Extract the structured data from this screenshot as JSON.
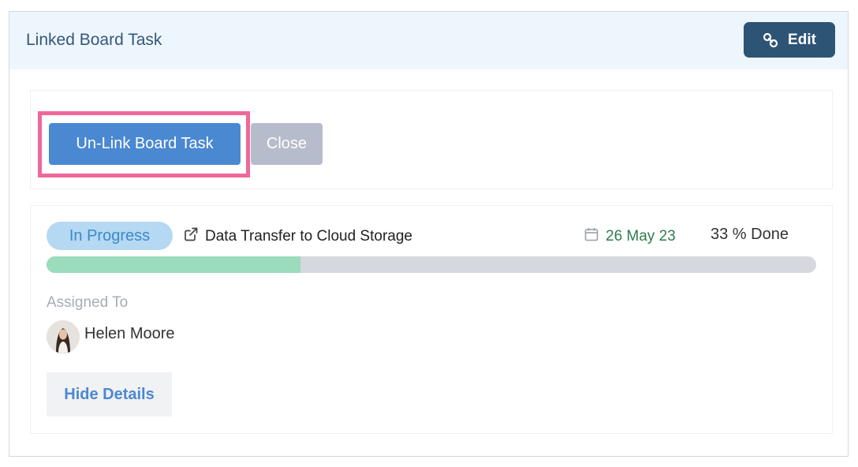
{
  "header": {
    "title": "Linked Board Task",
    "edit_label": "Edit",
    "edit_icon": "link-icon"
  },
  "actions": {
    "unlink_label": "Un-Link Board Task",
    "close_label": "Close"
  },
  "task": {
    "status": "In Progress",
    "title": "Data Transfer to Cloud Storage",
    "title_icon": "external-link-icon",
    "due_date": "26 May 23",
    "due_icon": "calendar-icon",
    "percent_done_label": "33 % Done",
    "progress": 0.33,
    "assigned_label": "Assigned To",
    "assignee": "Helen Moore",
    "hide_details_label": "Hide Details"
  },
  "colors": {
    "header_bg": "#eef6fd",
    "edit_button": "#2d5475",
    "primary_button": "#4a88d2",
    "close_button": "#b6bccb",
    "highlight": "#f0679a",
    "status_pill": "#b5d8f3",
    "progress_fill": "#9adcbc",
    "due_date_text": "#2f7a4f"
  }
}
